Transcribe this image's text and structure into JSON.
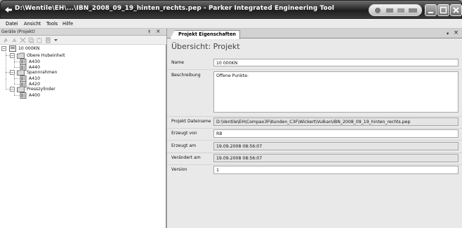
{
  "window": {
    "title": "D:\\Wentile\\EH\\...\\IBN_2008_09_19_hinten_rechts.pep - Parker Integrated Engineering Tool"
  },
  "menu": [
    {
      "label": "Datei"
    },
    {
      "label": "Ansicht"
    },
    {
      "label": "Tools"
    },
    {
      "label": "Hilfe"
    }
  ],
  "left_panel": {
    "title": "Geräte (Projekt)",
    "pin": "‡",
    "close": "×"
  },
  "tree": {
    "root": "10 000KN",
    "groups": [
      {
        "label": "Obere Hubeinheit",
        "children": [
          "A430",
          "A440"
        ]
      },
      {
        "label": "Spannrahmen",
        "children": [
          "A410",
          "A420"
        ]
      },
      {
        "label": "Presszylinder",
        "children": [
          "A400"
        ]
      }
    ]
  },
  "tab": {
    "label": "Projekt Eigenschaften",
    "dropdown": "▾",
    "close": "×"
  },
  "form": {
    "title": "Übersicht: Projekt",
    "fields": {
      "name": {
        "label": "Name",
        "value": "10 000KN"
      },
      "beschreibung": {
        "label": "Beschreibung",
        "value": "Offene Punkte:"
      },
      "dateiname": {
        "label": "Projekt Dateiname",
        "value": "D:\\Ventile\\EH\\Compax3F\\Kunden_C3F\\Wickert\\Vulkan\\IBN_2008_09_19_hinten_rechts.pep"
      },
      "erzeugt_von": {
        "label": "Erzeugt von",
        "value": "RB"
      },
      "erzeugt_am": {
        "label": "Erzeugt am",
        "value": "19.09.2008 08:56:07"
      },
      "veraendert_am": {
        "label": "Verändert am",
        "value": "19.09.2008 08:56:07"
      },
      "version": {
        "label": "Version",
        "value": "1"
      }
    }
  },
  "colors": {
    "titlebar": "#2f2f2f",
    "pane_bg": "#e9e9e9",
    "field_bg": "#ffffff",
    "readonly_bg": "#e4e4e4"
  }
}
